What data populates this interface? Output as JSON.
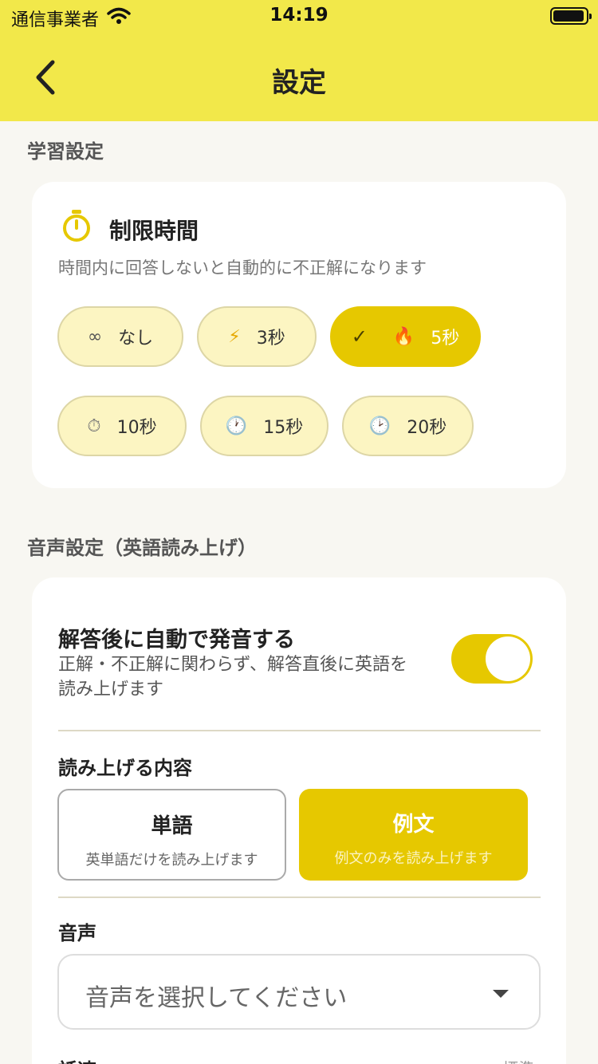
{
  "status_bar": {
    "carrier": "通信事業者",
    "time": "14:19"
  },
  "header": {
    "title": "設定"
  },
  "learning": {
    "section_label": "学習設定",
    "time_limit": {
      "title": "制限時間",
      "description": "時間内に回答しないと自動的に不正解になります",
      "options": [
        {
          "icon": "∞",
          "label": "なし",
          "selected": false
        },
        {
          "icon": "⚡",
          "label": "3秒",
          "selected": false
        },
        {
          "icon": "🔥",
          "label": "5秒",
          "selected": true
        },
        {
          "icon": "⏱",
          "label": "10秒",
          "selected": false
        },
        {
          "icon": "🕐",
          "label": "15秒",
          "selected": false
        },
        {
          "icon": "🕑",
          "label": "20秒",
          "selected": false
        }
      ]
    }
  },
  "audio": {
    "section_label": "音声設定（英語読み上げ）",
    "auto_speak": {
      "title": "解答後に自動で発音する",
      "description": "正解・不正解に関わらず、解答直後に英語を読み上げます",
      "enabled": true
    },
    "read_content": {
      "title": "読み上げる内容",
      "options": [
        {
          "title": "単語",
          "desc": "英単語だけを読み上げます",
          "selected": false
        },
        {
          "title": "例文",
          "desc": "例文のみを読み上げます",
          "selected": true
        }
      ]
    },
    "voice": {
      "title": "音声",
      "placeholder": "音声を選択してください"
    },
    "speed": {
      "title": "話速",
      "value": "標準"
    }
  },
  "colors": {
    "header_bg": "#f2e84a",
    "accent": "#e6c800",
    "chip_bg": "#fcf5c2",
    "page_bg": "#f8f7f2"
  }
}
